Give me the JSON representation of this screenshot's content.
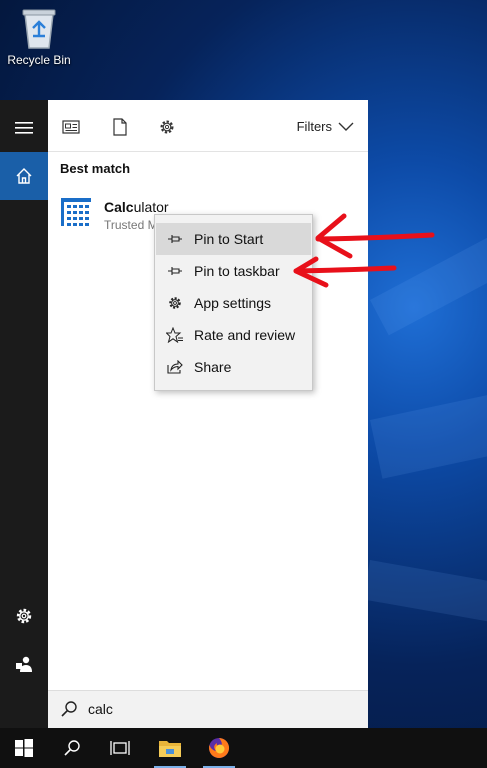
{
  "desktop": {
    "recycle_bin_label": "Recycle Bin"
  },
  "start": {
    "rail": {
      "icons": [
        "hamburger-icon",
        "home-icon",
        "settings-icon",
        "user-icon"
      ]
    },
    "toolbar": {
      "filters_label": "Filters",
      "icons": [
        "news-icon",
        "document-icon",
        "gear-icon",
        "chevron-down-icon"
      ]
    },
    "best_match_heading": "Best match",
    "result": {
      "name_highlight": "Calc",
      "name_rest": "ulator",
      "subtitle": "Trusted Microsoft Store app"
    },
    "search": {
      "query": "calc"
    }
  },
  "context_menu": {
    "items": [
      {
        "label": "Pin to Start",
        "icon": "pin-icon",
        "highlighted": true
      },
      {
        "label": "Pin to taskbar",
        "icon": "pin-icon",
        "highlighted": false
      },
      {
        "label": "App settings",
        "icon": "gear-icon",
        "highlighted": false
      },
      {
        "label": "Rate and review",
        "icon": "star-icon",
        "highlighted": false
      },
      {
        "label": "Share",
        "icon": "share-icon",
        "highlighted": false
      }
    ]
  },
  "annotations": {
    "arrow_color": "#e8101a",
    "arrows": [
      "points-to-pin-to-start",
      "points-to-pin-to-taskbar"
    ]
  },
  "taskbar": {
    "icons": [
      "windows-start-icon",
      "search-icon",
      "task-view-icon",
      "file-explorer-icon",
      "firefox-icon"
    ]
  },
  "colors": {
    "accent": "#1a5fa8",
    "rail": "#1b1b1b",
    "menu_hover": "#d9d9d9"
  }
}
